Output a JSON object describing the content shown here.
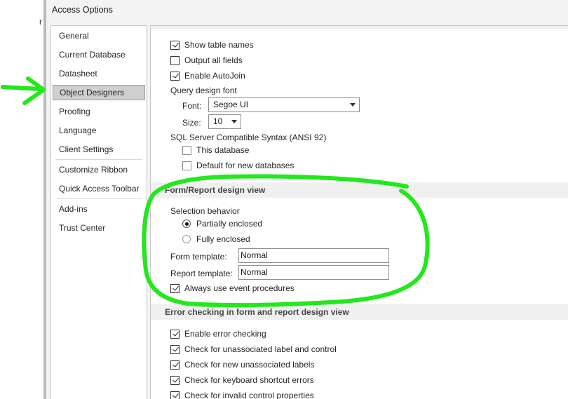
{
  "background_window": {
    "partial_text": "r"
  },
  "dialog": {
    "title": "Access Options"
  },
  "nav": {
    "items": [
      "General",
      "Current Database",
      "Datasheet",
      "Object Designers",
      "Proofing",
      "Language",
      "Client Settings",
      "Customize Ribbon",
      "Quick Access Toolbar",
      "Add-ins",
      "Trust Center"
    ],
    "selected": "Object Designers"
  },
  "query_design": {
    "show_table_names": {
      "label": "Show table names",
      "checked": true
    },
    "output_all_fields": {
      "label": "Output all fields",
      "checked": false
    },
    "enable_autojoin": {
      "label": "Enable AutoJoin",
      "checked": true
    },
    "font_heading": "Query design font",
    "font_label": "Font:",
    "font_value": "Segoe UI",
    "size_label": "Size:",
    "size_value": "10",
    "sql_heading": "SQL Server Compatible Syntax (ANSI 92)",
    "this_database": {
      "label": "This database",
      "checked": false
    },
    "default_new_db": {
      "label": "Default for new databases",
      "checked": false
    }
  },
  "form_report": {
    "header": "Form/Report design view",
    "selection_behavior_label": "Selection behavior",
    "partially_enclosed": {
      "label": "Partially enclosed",
      "selected": true
    },
    "fully_enclosed": {
      "label": "Fully enclosed",
      "selected": false
    },
    "form_template_label": "Form template:",
    "form_template_value": "Normal",
    "report_template_label": "Report template:",
    "report_template_value": "Normal",
    "always_event_procedures": {
      "label": "Always use event procedures",
      "checked": true
    }
  },
  "error_checking": {
    "header": "Error checking in form and report design view",
    "items": [
      {
        "label": "Enable error checking",
        "checked": true
      },
      {
        "label": "Check for unassociated label and control",
        "checked": true
      },
      {
        "label": "Check for new unassociated labels",
        "checked": true
      },
      {
        "label": "Check for keyboard shortcut errors",
        "checked": true
      },
      {
        "label": "Check for invalid control properties",
        "checked": true
      }
    ]
  },
  "annotation": {
    "color": "#22e81c",
    "marks": [
      "arrow-icon",
      "highlight-circle"
    ]
  }
}
